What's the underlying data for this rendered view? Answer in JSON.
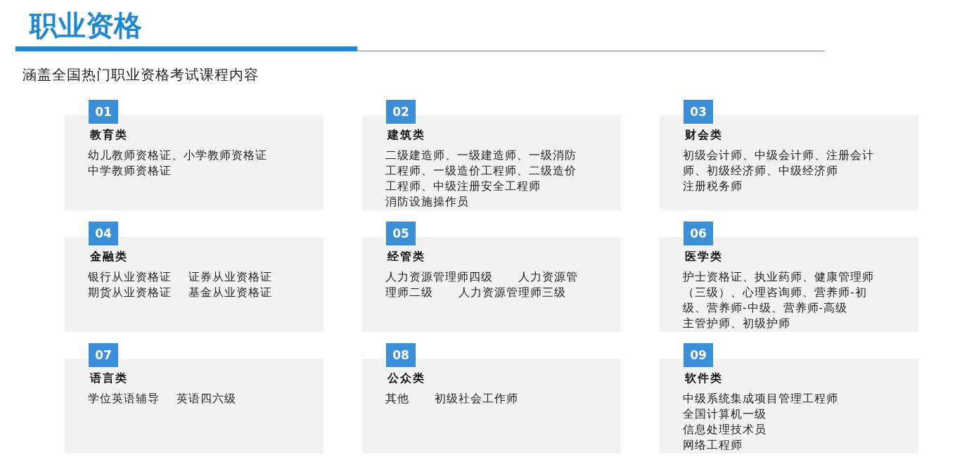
{
  "title": "职业资格",
  "subtitle": "涵盖全国热门职业资格考试课程内容",
  "categories": [
    {
      "number": "01",
      "name": "教育类",
      "lines": [
        "幼儿教师资格证、小学教师资格证",
        "中学教师资格证"
      ]
    },
    {
      "number": "02",
      "name": "建筑类",
      "lines": [
        "二级建造师、一级建造师、一级消防",
        "工程师、一级造价工程师、二级造价",
        "工程师、中级注册安全工程师",
        "消防设施操作员"
      ]
    },
    {
      "number": "03",
      "name": "财会类",
      "lines": [
        "初级会计师、中级会计师、注册会计",
        "师、初级经济师、中级经济师",
        "注册税务师"
      ]
    },
    {
      "number": "04",
      "name": "金融类",
      "lines": [
        "银行从业资格证    证券从业资格证",
        "期货从业资格证    基金从业资格证"
      ]
    },
    {
      "number": "05",
      "name": "经管类",
      "lines": [
        "人力资源管理师四级      人力资源管",
        "理师二级      人力资源管理师三级"
      ]
    },
    {
      "number": "06",
      "name": "医学类",
      "lines": [
        "护士资格证、执业药师、健康管理师",
        "（三级）、心理咨询师、营养师-初",
        "级、营养师-中级、营养师-高级",
        "主管护师、初级护师"
      ]
    },
    {
      "number": "07",
      "name": "语言类",
      "lines": [
        "学位英语辅导    英语四六级"
      ]
    },
    {
      "number": "08",
      "name": "公众类",
      "lines": [
        "其他      初级社会工作师"
      ]
    },
    {
      "number": "09",
      "name": "软件类",
      "lines": [
        "中级系统集成项目管理工程师",
        "全国计算机一级",
        "信息处理技术员",
        "网络工程师"
      ]
    }
  ]
}
